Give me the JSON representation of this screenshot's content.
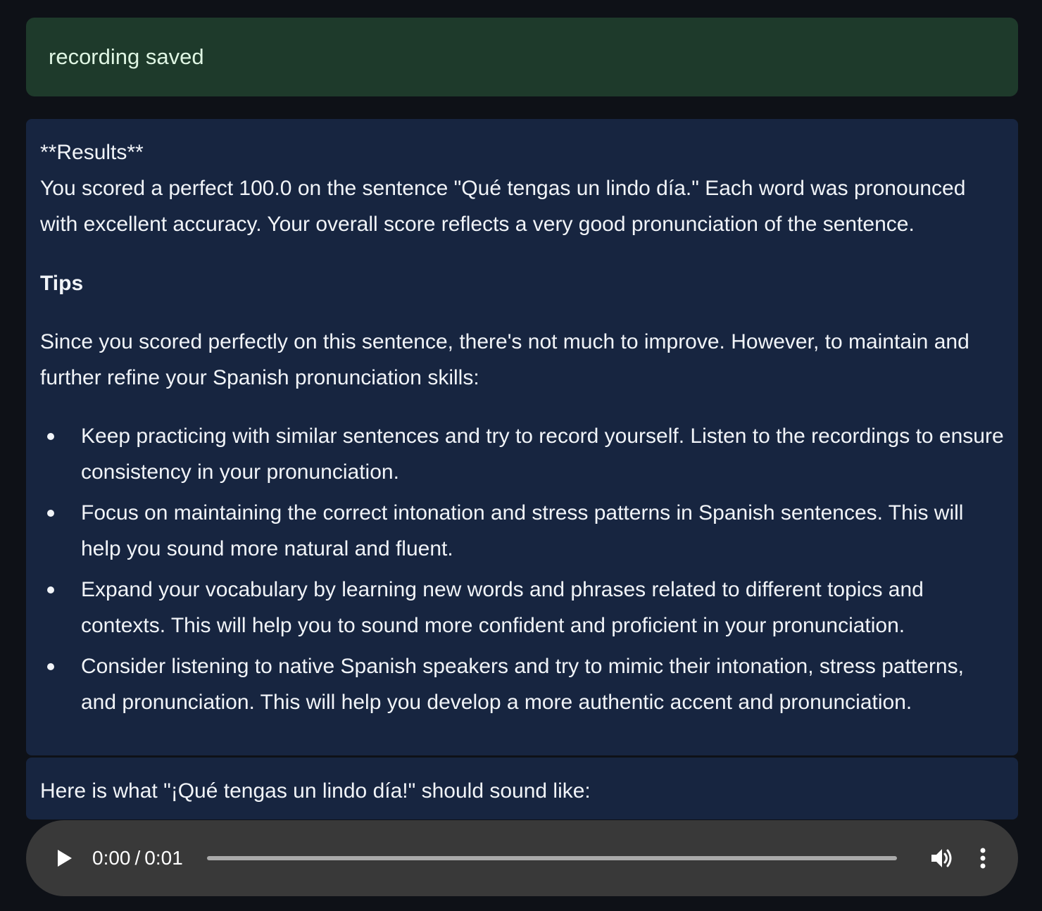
{
  "alert": {
    "message": "recording saved",
    "color": "#1e3a2b"
  },
  "results": {
    "heading": "**Results**",
    "summary": "You scored a perfect 100.0 on the sentence \"Qué tengas un lindo día.\" Each word was pronounced with excellent accuracy. Your overall score reflects a very good pronunciation of the sentence.",
    "tips_heading": "Tips",
    "tips_intro": "Since you scored perfectly on this sentence, there's not much to improve. However, to maintain and further refine your Spanish pronunciation skills:",
    "tips": [
      "Keep practicing with similar sentences and try to record yourself. Listen to the recordings to ensure consistency in your pronunciation.",
      "Focus on maintaining the correct intonation and stress patterns in Spanish sentences. This will help you sound more natural and fluent.",
      "Expand your vocabulary by learning new words and phrases related to different topics and contexts. This will help you to sound more confident and proficient in your pronunciation.",
      "Consider listening to native Spanish speakers and try to mimic their intonation, stress patterns, and pronunciation. This will help you develop a more authentic accent and pronunciation."
    ]
  },
  "audio_prompt": "Here is what \"¡Qué tengas un lindo día!\" should sound like:",
  "audio_player": {
    "current_time": "0:00",
    "separator": "/",
    "duration": "0:01",
    "progress": 0,
    "play_icon": "play-icon",
    "volume_icon": "volume-icon",
    "menu_icon": "more-vert-icon"
  },
  "colors": {
    "background": "#0e1117",
    "card": "#172540",
    "player": "#393939"
  }
}
